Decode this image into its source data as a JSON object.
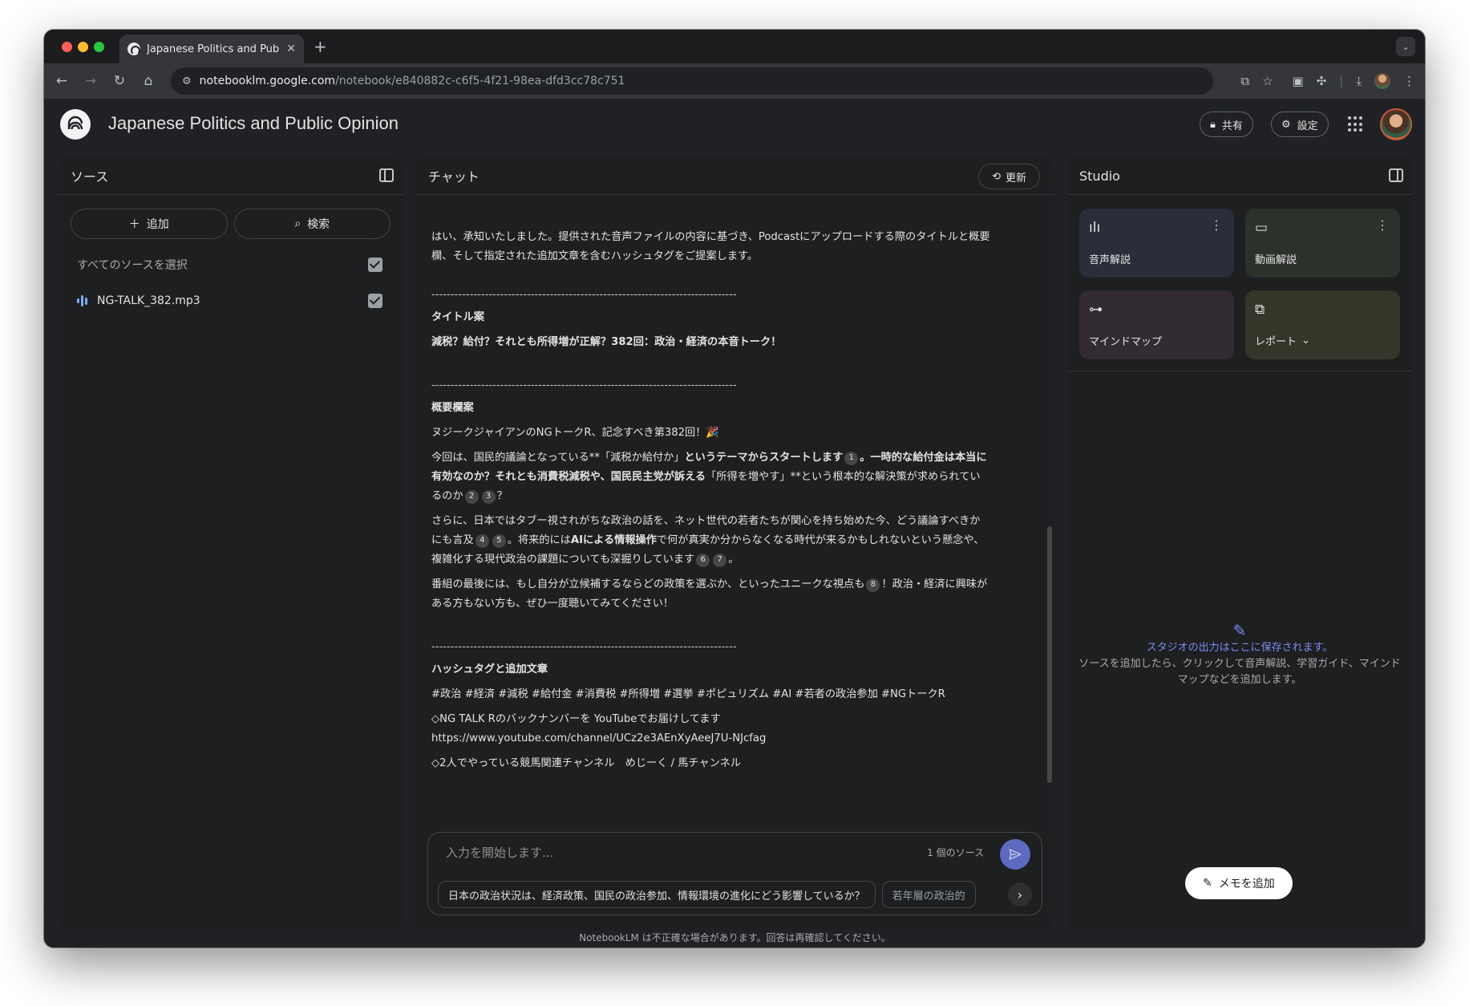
{
  "browser": {
    "tab_title": "Japanese Politics and Public O",
    "new_tab": "+",
    "url_host": "notebooklm.google.com",
    "url_path": "/notebook/e840882c-c6f5-4f21-98ea-dfd3cc78c751"
  },
  "app": {
    "title": "Japanese Politics and Public Opinion",
    "share_label": "共有",
    "settings_label": "設定"
  },
  "sources": {
    "heading": "ソース",
    "add_label": "追加",
    "search_label": "検索",
    "select_all_label": "すべてのソースを選択",
    "items": [
      {
        "name": "NG-TALK_382.mp3",
        "checked": true
      }
    ]
  },
  "chat": {
    "heading": "チャット",
    "refresh_label": "更新",
    "intro": "はい、承知いたしました。提供された音声ファイルの内容に基づき、Podcastにアップロードする際のタイトルと概要欄、そして指定された追加文章を含むハッシュタグをご提案します。",
    "separator": "--------------------------------------------------------------------------------",
    "title_heading": "タイトル案",
    "title_text": "減税？給付？それとも所得増が正解？382回：政治・経済の本音トーク！",
    "summary_heading": "概要欄案",
    "summary_p1": "ヌジークジャイアンのNGトークR、記念すべき第382回！🎉",
    "summary_p2_a": "今回は、国民的議論となっている**「減税か給付か」",
    "summary_p2_b": "というテーマからスタートします",
    "summary_p2_c": "。一時的な給付金は本当に有効なのか？それとも消費税減税や、国民民主党が訴える",
    "summary_p2_d": "「所得を増やす」**という根本的な解決策が求められているのか",
    "summary_p3_a": "さらに、日本ではタブー視されがちな政治の話を、ネット世代の若者たちが関心を持ち始めた今、どう議論すべきかにも言及",
    "summary_p3_b": "。将来的には",
    "summary_p3_c": "AIによる情報操作",
    "summary_p3_d": "で何が真実か分からなくなる時代が来るかもしれないという懸念や、複雑化する現代政治の課題についても深掘りしています",
    "summary_p4_a": "番組の最後には、もし自分が立候補するならどの政策を選ぶか、といったユニークな視点も",
    "summary_p4_b": "！政治・経済に興味がある方もない方も、ぜひ一度聴いてみてください！",
    "hashtag_heading": "ハッシュタグと追加文章",
    "hashtags": "#政治 #経済 #減税 #給付金 #消費税 #所得増 #選挙 #ポピュリズム #AI #若者の政治参加 #NGトークR",
    "backnumber": "◇NG TALK Rのバックナンバーを YouTubeでお届けしてます",
    "youtube_url": "https://www.youtube.com/channel/UCz2e3AEnXyAeeJ7U-NJcfag",
    "cutoff_line": "◇2人でやっている競馬関連チャンネル　めじーく / 馬チャンネル",
    "citations": {
      "c1": "1",
      "c2": "2",
      "c3": "3",
      "c4": "4",
      "c5": "5",
      "c6": "6",
      "c7": "7",
      "c8": "8"
    },
    "input_placeholder": "入力を開始します...",
    "source_count": "1 個のソース",
    "chips": [
      "日本の政治状況は、経済政策、国民の政治参加、情報環境の進化にどう影響しているか？",
      "若年層の政治的"
    ],
    "disclaimer": "NotebookLM は不正確な場合があります。回答は再確認してください。"
  },
  "studio": {
    "heading": "Studio",
    "tiles": [
      {
        "label": "音声解説",
        "icon": "audio-overview-icon"
      },
      {
        "label": "動画解説",
        "icon": "video-overview-icon"
      },
      {
        "label": "マインドマップ",
        "icon": "mind-map-icon"
      },
      {
        "label": "レポート",
        "icon": "report-icon"
      }
    ],
    "empty_title": "スタジオの出力はここに保存されます。",
    "empty_desc": "ソースを追加したら、クリックして音声解説、学習ガイド、マインドマップなどを追加します。",
    "add_memo_label": "メモを追加"
  },
  "colors": {
    "background": "#202124",
    "panel": "#1e1f20",
    "accent": "#7c8cf5",
    "send": "#5c6bc0"
  }
}
